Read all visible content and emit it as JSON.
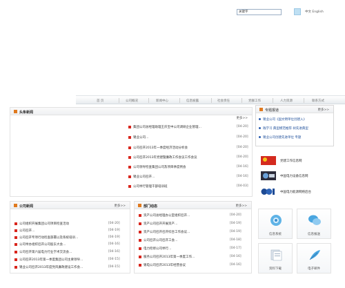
{
  "header": {
    "search_value": "关键字",
    "lang_links": "中文 English"
  },
  "nav": {
    "items": [
      "首 页",
      "公司概况",
      "新闻中心",
      "信息披露",
      "社会责任",
      "党群工作",
      "人力资源",
      "联系方式"
    ]
  },
  "headline": {
    "title": "头条新闻",
    "more": "更多>>",
    "items": [
      {
        "text": "集团公司总经理助理王庆宝中公司调研企业管理…",
        "date": "[04-20]"
      },
      {
        "text": "锡业公司…",
        "date": "[04-20]"
      },
      {
        "text": "公司召开2013年一季度经济活动分析会",
        "date": "[04-20]"
      },
      {
        "text": "公司召开2013年党建暨廉政工作会议工作会议",
        "date": "[04-20]"
      },
      {
        "text": "公司领导检查集团公司及项目季度例会",
        "date": "[04-16]"
      },
      {
        "text": "锡业公司召开…",
        "date": "[04-16]"
      },
      {
        "text": "公司举行管理干部培训班",
        "date": "[04-03]"
      }
    ]
  },
  "featured": {
    "title": "专题报道",
    "more": "更多>>",
    "items": [
      "锡业公司《国文明单位创建入》",
      "践学习 典型模范推荐 树先进典型",
      "锡业公司创建先进单位 专题"
    ]
  },
  "links": [
    {
      "text": "党建工作信息网"
    },
    {
      "text": "中国电力设备信息网"
    },
    {
      "text": "中国电力能源网络后台"
    }
  ],
  "company_news": {
    "title": "公司新闻",
    "more": "更多>>",
    "items": [
      {
        "text": "公司组织开展集团公司项目检查活动",
        "date": "[04-20]"
      },
      {
        "text": "公司召开…",
        "date": "[04-19]"
      },
      {
        "text": "公司召开专项行动检查部署以及系统培训…",
        "date": "[04-19]"
      },
      {
        "text": "公司举办组织召开公司股东大会…",
        "date": "[04-16]"
      },
      {
        "text": "公司召开第六届电力行业学术交流会…",
        "date": "[04-16]"
      },
      {
        "text": "公司召开2013年第一季度集团公司主要领导…",
        "date": "[04-15]"
      },
      {
        "text": "锡业公司召开2013年度党风廉政建设工作会…",
        "date": "[04-15]"
      }
    ]
  },
  "dept_news": {
    "title": "部门动态",
    "more": "更多>>",
    "items": [
      {
        "text": "资产公司总经理办公室组织召开…",
        "date": "[04-20]"
      },
      {
        "text": "资产公司召开开展资产…",
        "date": "[04-19]"
      },
      {
        "text": "资产公司召开召开综合工作会议…",
        "date": "[04-19]"
      },
      {
        "text": "公司召开公司召开工会…",
        "date": "[04-18]"
      },
      {
        "text": "电力检修公司举行…",
        "date": "[04-17]"
      },
      {
        "text": "服务公司召开2013年第一季度工作…",
        "date": "[04-16]"
      },
      {
        "text": "锡电公司召开2013年经营会议",
        "date": "[04-16]"
      }
    ]
  },
  "tiles": [
    {
      "label": "信息系统",
      "icon": "gear-globe-icon"
    },
    {
      "label": "信息报送",
      "icon": "chat-bubbles-icon"
    },
    {
      "label": "资料下载",
      "icon": "document-stack-icon"
    },
    {
      "label": "电子邮件",
      "icon": "feather-icon"
    }
  ],
  "colors": {
    "accent_orange": "#e07a1f",
    "bullet_red": "#d9251c",
    "link_blue": "#1f4f9a"
  }
}
